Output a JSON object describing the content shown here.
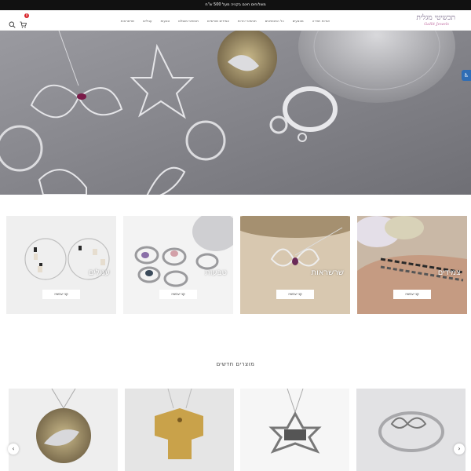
{
  "topbar": {
    "text": "משלוחים חינם בקניה מעל 500 ש\"ח"
  },
  "logo": {
    "main": "תכשיטי מגלית",
    "sub": "Gallit Jewels"
  },
  "nav": {
    "items": [
      "שרשראות",
      "עגילים",
      "טבעות",
      "תכשיטי מוסלם",
      "צמידים שורשיים",
      "תכשיטי יהדות",
      "כל התכשיטים",
      "מבצעים",
      "אודות ויצירה"
    ]
  },
  "cart": {
    "count": "0"
  },
  "categories": [
    {
      "title": "עגילים",
      "button": "קני עכשיו"
    },
    {
      "title": "טבעות",
      "button": "קני עכשיו"
    },
    {
      "title": "שרשראות",
      "button": "קני עכשיו"
    },
    {
      "title": "צמידים",
      "button": "קני עכשיו"
    }
  ],
  "new_products": {
    "title": "מוצרים חדשים"
  },
  "colors": {
    "topbar": "#111111",
    "badge": "#d8262c",
    "accessibility": "#2f6db5"
  }
}
